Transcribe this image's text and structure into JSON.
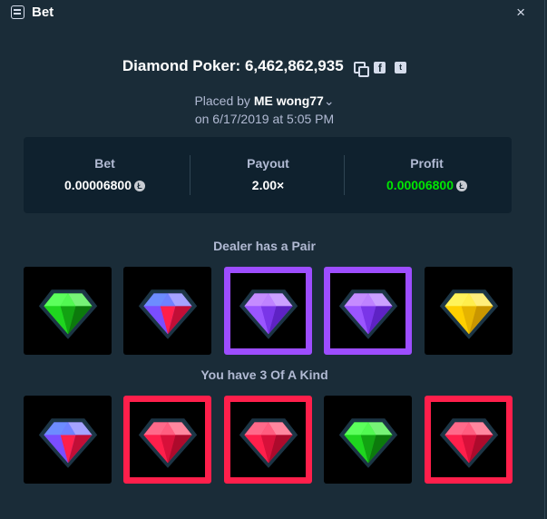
{
  "header": {
    "title": "Bet",
    "close": "×"
  },
  "game": {
    "title": "Diamond Poker: 6,462,862,935"
  },
  "placed": {
    "prefix": "Placed by",
    "user": "ME wong77",
    "date": "on 6/17/2019 at 5:05 PM"
  },
  "stats": {
    "bet_label": "Bet",
    "bet_value": "0.00006800",
    "payout_label": "Payout",
    "payout_value": "2.00×",
    "profit_label": "Profit",
    "profit_value": "0.00006800"
  },
  "dealer": {
    "caption": "Dealer has a Pair",
    "gems": [
      {
        "color": "green",
        "highlight": "none"
      },
      {
        "color": "blue-red",
        "highlight": "none"
      },
      {
        "color": "purple",
        "highlight": "purple"
      },
      {
        "color": "purple",
        "highlight": "purple"
      },
      {
        "color": "yellow",
        "highlight": "none"
      }
    ]
  },
  "player": {
    "caption": "You have 3 Of A Kind",
    "gems": [
      {
        "color": "blue-red",
        "highlight": "none"
      },
      {
        "color": "red",
        "highlight": "red"
      },
      {
        "color": "red",
        "highlight": "red"
      },
      {
        "color": "green",
        "highlight": "none"
      },
      {
        "color": "red",
        "highlight": "red"
      }
    ]
  },
  "colors": {
    "accent_green": "#00e701",
    "purple_border": "#9d4dff",
    "red_border": "#ff1f4b",
    "bg": "#1a2c38",
    "panel": "#0f212e"
  },
  "icons": [
    "bet-icon",
    "close-icon",
    "copy-icon",
    "facebook-icon",
    "twitter-icon",
    "chevron-down-icon",
    "coin-icon",
    "gem-icon"
  ]
}
